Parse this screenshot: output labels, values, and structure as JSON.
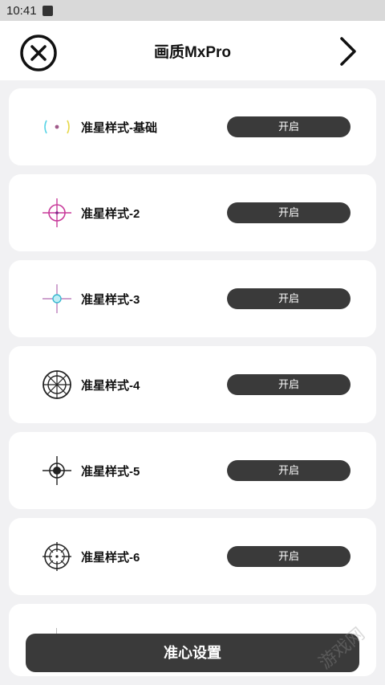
{
  "status": {
    "time": "10:41"
  },
  "header": {
    "title": "画质MxPro",
    "close_icon": "close-circle-icon",
    "next_icon": "chevron-right-icon"
  },
  "items": [
    {
      "label": "准星样式-基础",
      "button": "开启",
      "icon": "crosshair-basic-icon"
    },
    {
      "label": "准星样式-2",
      "button": "开启",
      "icon": "crosshair-2-icon"
    },
    {
      "label": "准星样式-3",
      "button": "开启",
      "icon": "crosshair-3-icon"
    },
    {
      "label": "准星样式-4",
      "button": "开启",
      "icon": "crosshair-4-icon"
    },
    {
      "label": "准星样式-5",
      "button": "开启",
      "icon": "crosshair-5-icon"
    },
    {
      "label": "准星样式-6",
      "button": "开启",
      "icon": "crosshair-6-icon"
    }
  ],
  "bottom": {
    "button_label": "准心设置"
  },
  "watermark": {
    "text": "游戏网"
  },
  "colors": {
    "button_bg": "#3a3a3a",
    "card_bg": "#ffffff",
    "page_bg": "#f1f1f3"
  }
}
